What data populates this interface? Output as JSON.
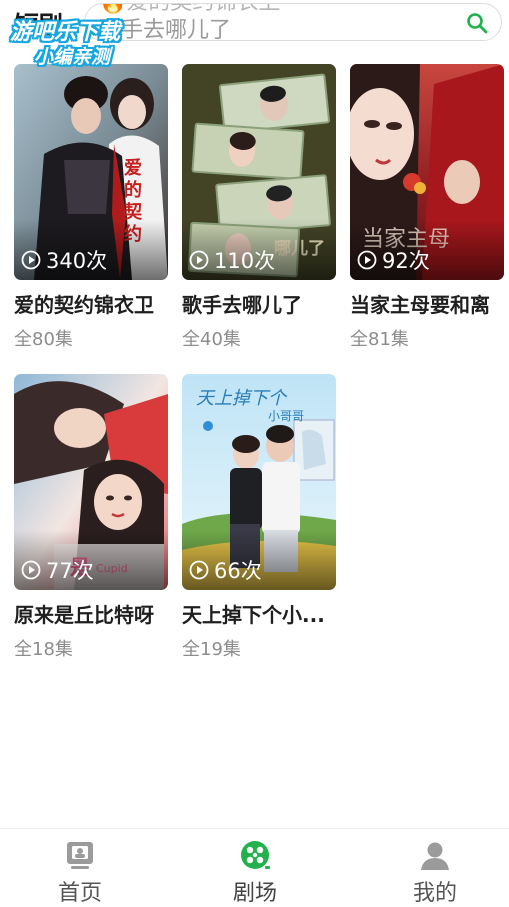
{
  "header": {
    "logo_text": "短剧",
    "search_suggestions": [
      "🔥爱的契约锦衣卫",
      "歌手去哪儿了"
    ],
    "search_icon": "search-icon"
  },
  "watermark": {
    "line1": "游吧乐下载",
    "line2": "小编亲测"
  },
  "dramas": [
    {
      "title": "爱的契约锦衣卫",
      "views": "340次",
      "episodes": "全80集"
    },
    {
      "title": "歌手去哪儿了",
      "views": "110次",
      "episodes": "全40集"
    },
    {
      "title": "当家主母要和离",
      "views": "92次",
      "episodes": "全81集"
    },
    {
      "title": "原来是丘比特呀",
      "views": "77次",
      "episodes": "全18集"
    },
    {
      "title": "天上掉下个小...",
      "views": "66次",
      "episodes": "全19集"
    }
  ],
  "nav": {
    "items": [
      {
        "label": "首页",
        "icon": "home-icon"
      },
      {
        "label": "剧场",
        "icon": "theater-icon",
        "active": true
      },
      {
        "label": "我的",
        "icon": "profile-icon"
      }
    ]
  },
  "colors": {
    "accent_green": "#22b14c",
    "nav_gray": "#9b9b9b",
    "watermark_blue": "#16a6e0"
  }
}
